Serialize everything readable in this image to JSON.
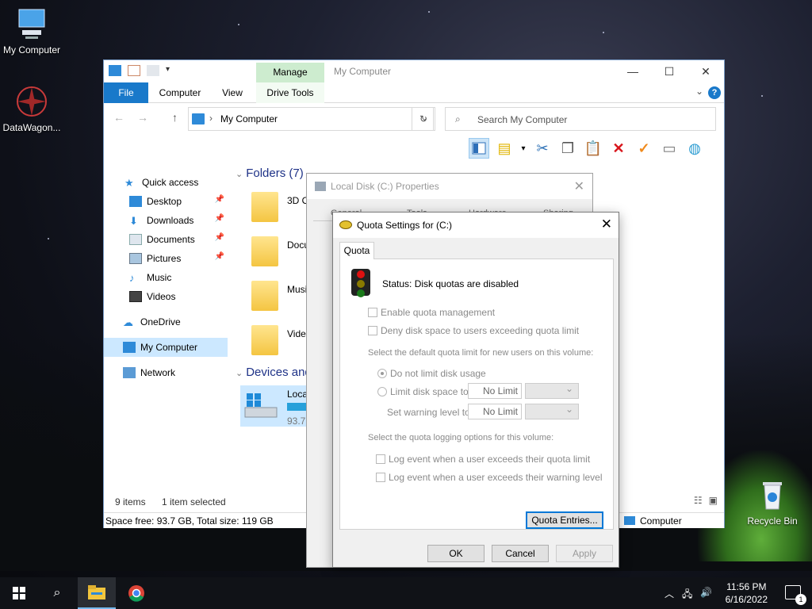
{
  "desktop": {
    "icons": [
      {
        "label": "My Computer"
      },
      {
        "label": "DataWagon..."
      },
      {
        "label": "Recycle Bin"
      }
    ]
  },
  "explorer": {
    "title": "My Computer",
    "manage_tab": "Manage",
    "ribbon_tabs": {
      "file": "File",
      "computer": "Computer",
      "view": "View",
      "drive_tools": "Drive Tools"
    },
    "address": "My Computer",
    "search_placeholder": "Search My Computer",
    "nav": {
      "quick_access": "Quick access",
      "desktop": "Desktop",
      "downloads": "Downloads",
      "documents": "Documents",
      "pictures": "Pictures",
      "music": "Music",
      "videos": "Videos",
      "onedrive": "OneDrive",
      "my_computer": "My Computer",
      "network": "Network"
    },
    "content": {
      "folders_header": "Folders (7)",
      "devices_header": "Devices and",
      "folders": [
        "3D O",
        "Docu",
        "Musi",
        "Vide"
      ],
      "drive_label": "Loca",
      "drive_free": "93.7"
    },
    "status": {
      "items": "9 items",
      "selected": "1 item selected"
    },
    "footer": {
      "left": "Space free: 93.7 GB, Total size: 119 GB",
      "right": "Computer"
    }
  },
  "properties": {
    "title": "Local Disk (C:) Properties",
    "tabs": [
      "General",
      "Tools",
      "Hardware",
      "Sharing"
    ]
  },
  "quota": {
    "title": "Quota Settings for  (C:)",
    "tab": "Quota",
    "status": "Status:  Disk quotas are disabled",
    "enable": "Enable quota management",
    "deny": "Deny disk space to users exceeding quota limit",
    "default_limit_label": "Select the default quota limit for new users on this volume:",
    "no_limit_radio": "Do not limit disk usage",
    "limit_radio": "Limit disk space to",
    "warning_label": "Set warning level to",
    "limit_value": "No Limit",
    "warning_value": "No Limit",
    "logging_label": "Select the quota logging options for this volume:",
    "log_limit": "Log event when a user exceeds their quota limit",
    "log_warning": "Log event when a user exceeds their warning level",
    "entries_button": "Quota Entries...",
    "ok": "OK",
    "cancel": "Cancel",
    "apply": "Apply"
  },
  "taskbar": {
    "time": "11:56 PM",
    "date": "6/16/2022",
    "notification_count": "1"
  }
}
